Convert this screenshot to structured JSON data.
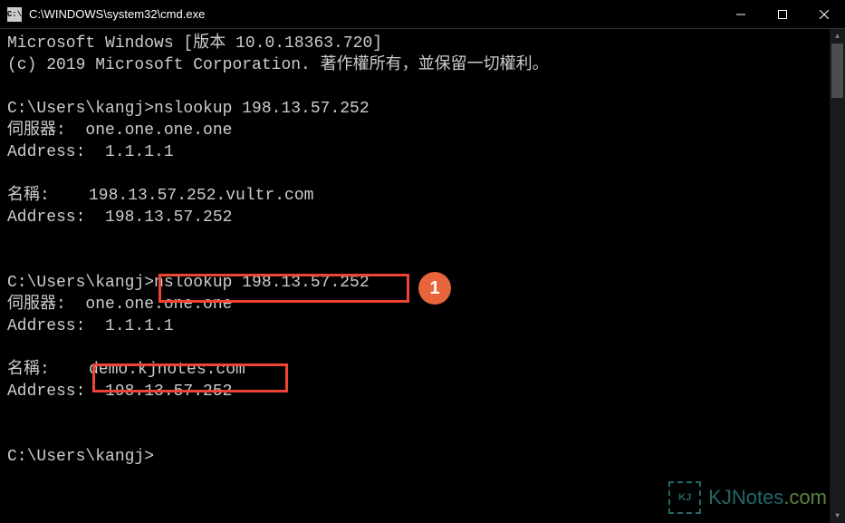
{
  "titlebar": {
    "icon_label": "C:\\",
    "title": "C:\\WINDOWS\\system32\\cmd.exe"
  },
  "terminal": {
    "lines": [
      "Microsoft Windows [版本 10.0.18363.720]",
      "(c) 2019 Microsoft Corporation. 著作權所有，並保留一切權利。",
      "",
      "C:\\Users\\kangj>nslookup 198.13.57.252",
      "伺服器:  one.one.one.one",
      "Address:  1.1.1.1",
      "",
      "名稱:    198.13.57.252.vultr.com",
      "Address:  198.13.57.252",
      "",
      "",
      "C:\\Users\\kangj>nslookup 198.13.57.252",
      "伺服器:  one.one.one.one",
      "Address:  1.1.1.1",
      "",
      "名稱:    demo.kjnotes.com",
      "Address:  198.13.57.252",
      "",
      "",
      "C:\\Users\\kangj>"
    ]
  },
  "annotations": {
    "badge_1": "1"
  },
  "watermark": {
    "icon_text": "KJ",
    "text_main": "KJNotes",
    "text_suffix": ".com"
  }
}
